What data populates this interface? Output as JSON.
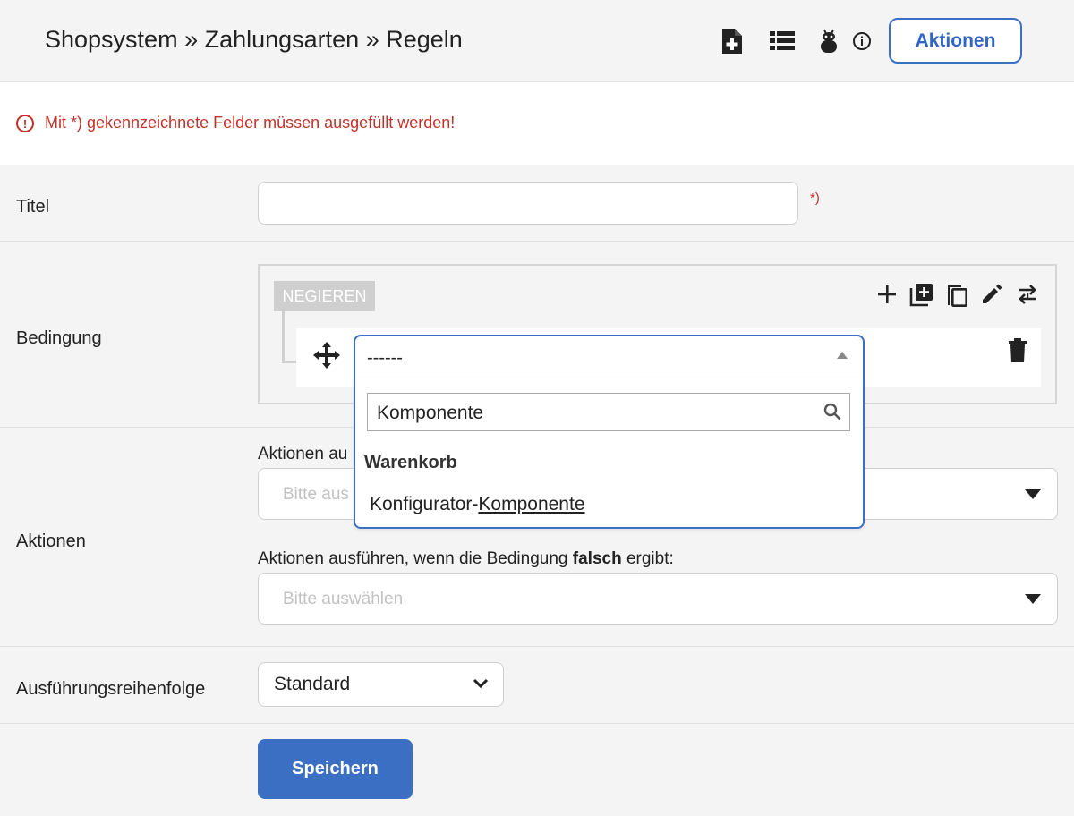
{
  "header": {
    "breadcrumb": "Shopsystem » Zahlungsarten » Regeln",
    "actions_label": "Aktionen",
    "icons": [
      "file-add-icon",
      "list-icon",
      "bug-icon",
      "info-icon"
    ]
  },
  "alert": {
    "icon_text": "!",
    "text": "Mit *) gekennzeichnete Felder müssen ausgefüllt werden!"
  },
  "form": {
    "title": {
      "label": "Titel",
      "value": "",
      "required_marker": "*)"
    },
    "condition": {
      "label": "Bedingung",
      "negate_label": "NEGIEREN",
      "toolbar_icons": [
        "plus-icon",
        "add-group-icon",
        "copy-icon",
        "edit-icon",
        "replace-icon"
      ],
      "select": {
        "value": "------",
        "search_value": "Komponente",
        "group_label": "Warenkorb",
        "option_prefix": "Konfigurator-",
        "option_match": "Komponente"
      }
    },
    "actions": {
      "label": "Aktionen",
      "true_label_visible": "Aktionen au",
      "true_placeholder_visible": "Bitte aus",
      "false_label_prefix": "Aktionen ausführen, wenn die Bedingung ",
      "false_label_bold": "falsch",
      "false_label_suffix": " ergibt:",
      "false_placeholder": "Bitte auswählen"
    },
    "order": {
      "label": "Ausführungsreihenfolge",
      "value": "Standard"
    },
    "save_label": "Speichern"
  },
  "colors": {
    "accent": "#3b6fc4",
    "error": "#c0332a",
    "background": "#f4f4f4"
  }
}
